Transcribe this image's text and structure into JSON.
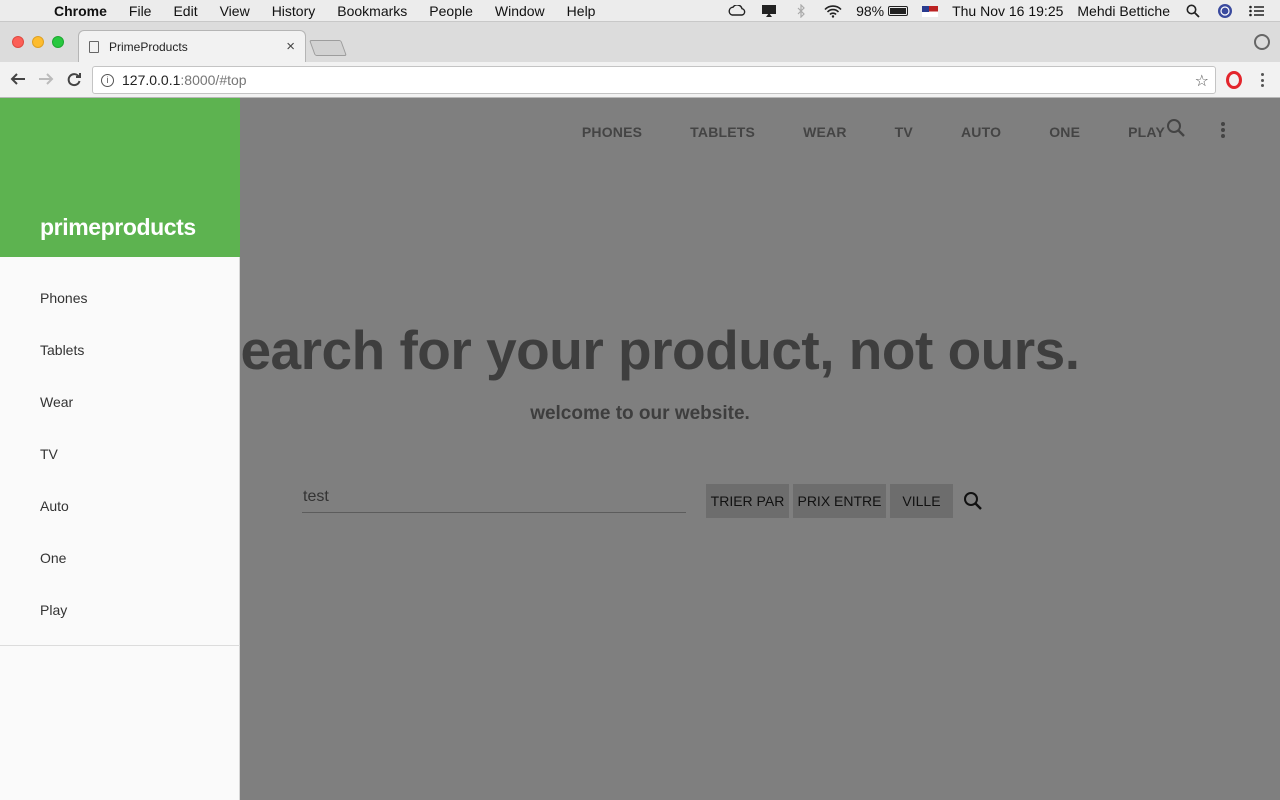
{
  "macos": {
    "apple_icon": "apple-logo-icon",
    "app_name": "Chrome",
    "menus": [
      "File",
      "Edit",
      "View",
      "History",
      "Bookmarks",
      "People",
      "Window",
      "Help"
    ],
    "battery_percent": "98%",
    "battery_level": 0.98,
    "datetime": "Thu Nov 16  19:25",
    "user": "Mehdi Bettiche"
  },
  "browser": {
    "tab_title": "PrimeProducts",
    "tab_close": "×",
    "url_host": "127.0.0.1",
    "url_path": ":8000/#top"
  },
  "site": {
    "nav": [
      "PHONES",
      "TABLETS",
      "WEAR",
      "TV",
      "AUTO",
      "ONE",
      "PLAY"
    ],
    "hero_title": "earch for your product, not ours.",
    "hero_subtitle": "welcome to our website.",
    "search_value": "test",
    "filters": {
      "sort_label": "TRIER PAR",
      "price_label": "PRIX ENTRE",
      "city_label": "VILLE"
    }
  },
  "drawer": {
    "brand": "primeproducts",
    "items": [
      "Phones",
      "Tablets",
      "Wear",
      "TV",
      "Auto",
      "One",
      "Play"
    ],
    "header_color": "#5db350"
  }
}
